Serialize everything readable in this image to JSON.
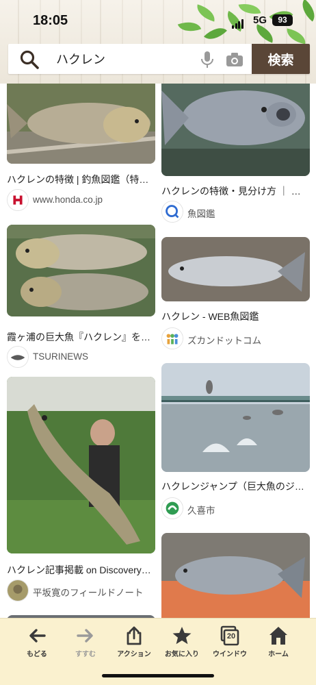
{
  "status_bar": {
    "time": "18:05",
    "network": "5G",
    "battery": "93"
  },
  "search": {
    "query": "ハクレン",
    "button_label": "検索"
  },
  "results": [
    {
      "title": "ハクレンの特徴 | 釣魚図鑑（特…",
      "source": "www.honda.co.jp",
      "favicon": "honda-logo-icon"
    },
    {
      "title": "ハクレンの特徴・見分け方 ｜ …",
      "source": "魚図鑑",
      "favicon": "fish-zukan-logo-icon"
    },
    {
      "title": "霞ヶ浦の巨大魚『ハクレン』を…",
      "source": "TSURINEWS",
      "favicon": "tsurinews-logo-icon"
    },
    {
      "title": "ハクレン - WEB魚図鑑",
      "source": "ズカンドットコム",
      "favicon": "zukan-com-logo-icon"
    },
    {
      "title": "ハクレン記事掲載 on Discovery…",
      "source": "平坂寛のフィールドノート",
      "favicon": "field-note-logo-icon"
    },
    {
      "title": "ハクレンジャンプ（巨大魚のジ…",
      "source": "久喜市",
      "favicon": "kuki-city-logo-icon"
    }
  ],
  "toolbar": [
    {
      "label": "もどる",
      "icon": "back-arrow-icon",
      "enabled": true
    },
    {
      "label": "すすむ",
      "icon": "forward-arrow-icon",
      "enabled": false
    },
    {
      "label": "アクション",
      "icon": "share-icon",
      "enabled": true
    },
    {
      "label": "お気に入り",
      "icon": "star-icon",
      "enabled": true
    },
    {
      "label": "ウインドウ",
      "icon": "windows-icon",
      "enabled": true,
      "count": "20"
    },
    {
      "label": "ホーム",
      "icon": "home-icon",
      "enabled": true
    }
  ],
  "colors": {
    "search_button": "#5a4637",
    "toolbar_bg": "#faf1cf",
    "leaf_green": "#6fb84a"
  }
}
